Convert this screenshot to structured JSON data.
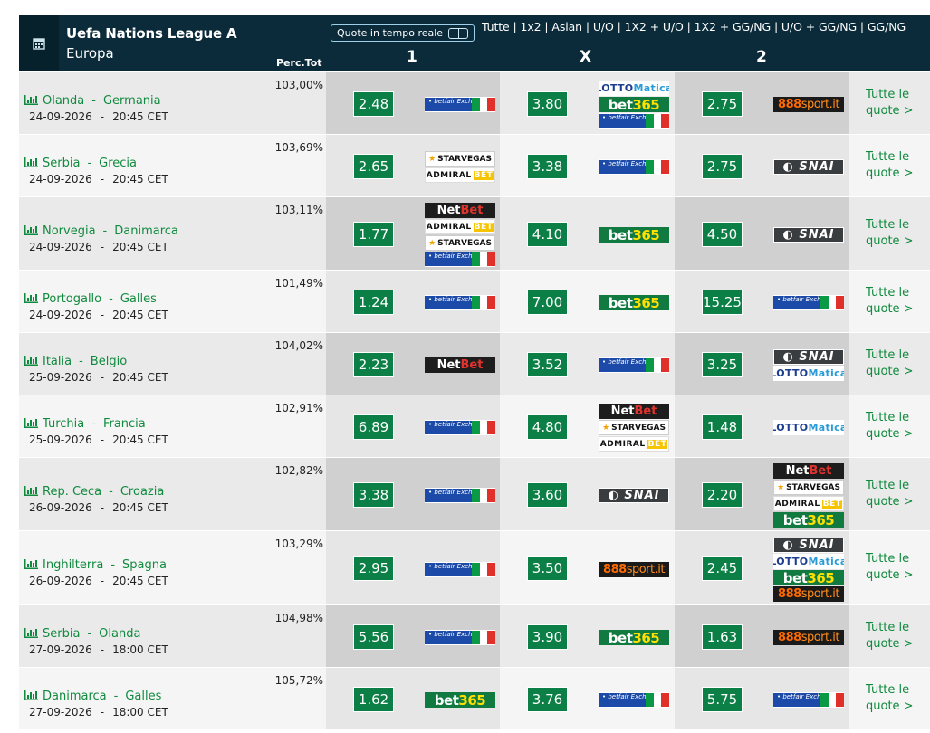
{
  "header": {
    "competition": "Uefa Nations League A",
    "region": "Europa",
    "live_label": "Quote in tempo reale",
    "markets": "Tutte | 1x2 | Asian | U/O | 1X2 + U/O | 1X2 + GG/NG | U/O + GG/NG | GG/NG",
    "perc_label": "Perc.Tot",
    "col_1": "1",
    "col_x": "X",
    "col_2": "2"
  },
  "colors": {
    "header_bg": "#0b2b3a",
    "odds_bg": "#0b7f45",
    "link": "#108a3e"
  },
  "more_label_1": "Tutte le",
  "more_label_2": "quote >",
  "matches": [
    {
      "home": "Olanda",
      "away": "Germania",
      "date": "24-09-2026",
      "time": "20:45 CET",
      "perc": "103,00%",
      "o1": "2.48",
      "b1": [
        "betfair"
      ],
      "ox": "3.80",
      "bx": [
        "lottomatica",
        "bet365",
        "betfair"
      ],
      "o2": "2.75",
      "b2": [
        "888sport"
      ]
    },
    {
      "home": "Serbia",
      "away": "Grecia",
      "date": "24-09-2026",
      "time": "20:45 CET",
      "perc": "103,69%",
      "o1": "2.65",
      "b1": [
        "starvegas",
        "admiralbet"
      ],
      "ox": "3.38",
      "bx": [
        "betfair"
      ],
      "o2": "2.75",
      "b2": [
        "snai"
      ]
    },
    {
      "home": "Norvegia",
      "away": "Danimarca",
      "date": "24-09-2026",
      "time": "20:45 CET",
      "perc": "103,11%",
      "o1": "1.77",
      "b1": [
        "netbet",
        "admiralbet",
        "starvegas",
        "betfair"
      ],
      "ox": "4.10",
      "bx": [
        "bet365"
      ],
      "o2": "4.50",
      "b2": [
        "snai"
      ]
    },
    {
      "home": "Portogallo",
      "away": "Galles",
      "date": "24-09-2026",
      "time": "20:45 CET",
      "perc": "101,49%",
      "o1": "1.24",
      "b1": [
        "betfair"
      ],
      "ox": "7.00",
      "bx": [
        "bet365"
      ],
      "o2": "15.25",
      "b2": [
        "betfair"
      ]
    },
    {
      "home": "Italia",
      "away": "Belgio",
      "date": "25-09-2026",
      "time": "20:45 CET",
      "perc": "104,02%",
      "o1": "2.23",
      "b1": [
        "netbet"
      ],
      "ox": "3.52",
      "bx": [
        "betfair"
      ],
      "o2": "3.25",
      "b2": [
        "snai",
        "lottomatica"
      ]
    },
    {
      "home": "Turchia",
      "away": "Francia",
      "date": "25-09-2026",
      "time": "20:45 CET",
      "perc": "102,91%",
      "o1": "6.89",
      "b1": [
        "betfair"
      ],
      "ox": "4.80",
      "bx": [
        "netbet",
        "starvegas",
        "admiralbet"
      ],
      "o2": "1.48",
      "b2": [
        "lottomatica"
      ]
    },
    {
      "home": "Rep. Ceca",
      "away": "Croazia",
      "date": "26-09-2026",
      "time": "20:45 CET",
      "perc": "102,82%",
      "o1": "3.38",
      "b1": [
        "betfair"
      ],
      "ox": "3.60",
      "bx": [
        "snai"
      ],
      "o2": "2.20",
      "b2": [
        "netbet",
        "starvegas",
        "admiralbet",
        "bet365"
      ]
    },
    {
      "home": "Inghilterra",
      "away": "Spagna",
      "date": "26-09-2026",
      "time": "20:45 CET",
      "perc": "103,29%",
      "o1": "2.95",
      "b1": [
        "betfair"
      ],
      "ox": "3.50",
      "bx": [
        "888sport"
      ],
      "o2": "2.45",
      "b2": [
        "snai",
        "lottomatica",
        "bet365",
        "888sport"
      ]
    },
    {
      "home": "Serbia",
      "away": "Olanda",
      "date": "27-09-2026",
      "time": "18:00 CET",
      "perc": "104,98%",
      "o1": "5.56",
      "b1": [
        "betfair"
      ],
      "ox": "3.90",
      "bx": [
        "bet365"
      ],
      "o2": "1.63",
      "b2": [
        "888sport"
      ]
    },
    {
      "home": "Danimarca",
      "away": "Galles",
      "date": "27-09-2026",
      "time": "18:00 CET",
      "perc": "105,72%",
      "o1": "1.62",
      "b1": [
        "bet365"
      ],
      "ox": "3.76",
      "bx": [
        "betfair"
      ],
      "o2": "5.75",
      "b2": [
        "betfair"
      ]
    }
  ],
  "bookmakers": {
    "betfair": {
      "text": "betfair",
      "sub": "Exchange"
    },
    "bet365": {
      "a": "bet",
      "b": "365"
    },
    "lottomatica": {
      "a": "LOTTO",
      "b": "Matica"
    },
    "888sport": {
      "a": "888",
      "b": "sport.it"
    },
    "snai": {
      "text": "SNAI"
    },
    "netbet": {
      "a": "Net",
      "b": "Bet"
    },
    "starvegas": {
      "text": "STARVEGAS"
    },
    "admiralbet": {
      "a": "ADMIRAL",
      "b": "BET"
    }
  }
}
